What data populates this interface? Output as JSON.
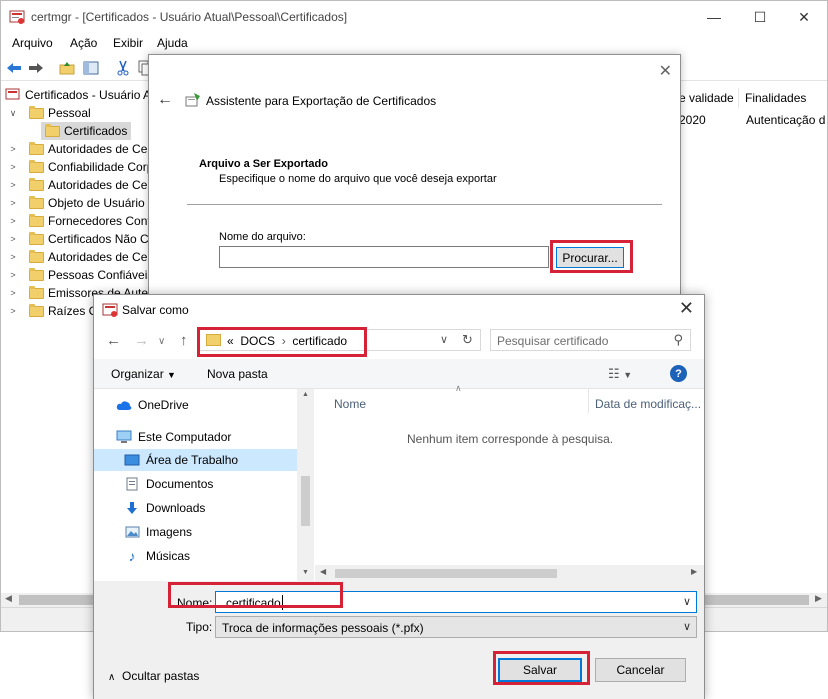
{
  "main": {
    "title": "certmgr - [Certificados - Usuário Atual\\Pessoal\\Certificados]",
    "menu": [
      "Arquivo",
      "Ação",
      "Exibir",
      "Ajuda"
    ],
    "tree": {
      "root": "Certificados - Usuário A",
      "pessoal": "Pessoal",
      "certificados": "Certificados",
      "items": [
        "Autoridades de Cer",
        "Confiabilidade Corp",
        "Autoridades de Cer",
        "Objeto de Usuário d",
        "Fornecedores Confi",
        "Certificados Não Co",
        "Autoridades de Cer",
        "Pessoas Confiáveis",
        "Emissores de Auten",
        "Raízes Cer"
      ]
    },
    "columns": {
      "validity": "e validade",
      "purposes": "Finalidades"
    },
    "row": {
      "validity": "2020",
      "purposes": "Autenticação d"
    }
  },
  "wizard": {
    "title": "Assistente para Exportação de Certificados",
    "section_title": "Arquivo a Ser Exportado",
    "section_desc": "Especifique o nome do arquivo que você deseja exportar",
    "file_label": "Nome do arquivo:",
    "file_value": "",
    "browse_label": "Procurar..."
  },
  "saveas": {
    "title": "Salvar como",
    "address": {
      "prefix": "«",
      "segments": [
        "DOCS",
        "certificado"
      ]
    },
    "search_placeholder": "Pesquisar certificado",
    "organize_label": "Organizar",
    "new_folder_label": "Nova pasta",
    "nav": {
      "onedrive": "OneDrive",
      "computer": "Este Computador",
      "desktop": "Área de Trabalho",
      "documents": "Documentos",
      "downloads": "Downloads",
      "images": "Imagens",
      "music": "Músicas"
    },
    "columns": {
      "name": "Nome",
      "date": "Data de modificaç..."
    },
    "empty_message": "Nenhum item corresponde à pesquisa.",
    "name_label": "Nome:",
    "name_value": "certificado",
    "type_label": "Tipo:",
    "type_value": "Troca de informações pessoais (*.pfx)",
    "hide_folders_label": "Ocultar pastas",
    "save_label": "Salvar",
    "cancel_label": "Cancelar"
  },
  "colors": {
    "highlight": "#d62236",
    "accent": "#0078d7",
    "folder": "#f1cf6b"
  }
}
